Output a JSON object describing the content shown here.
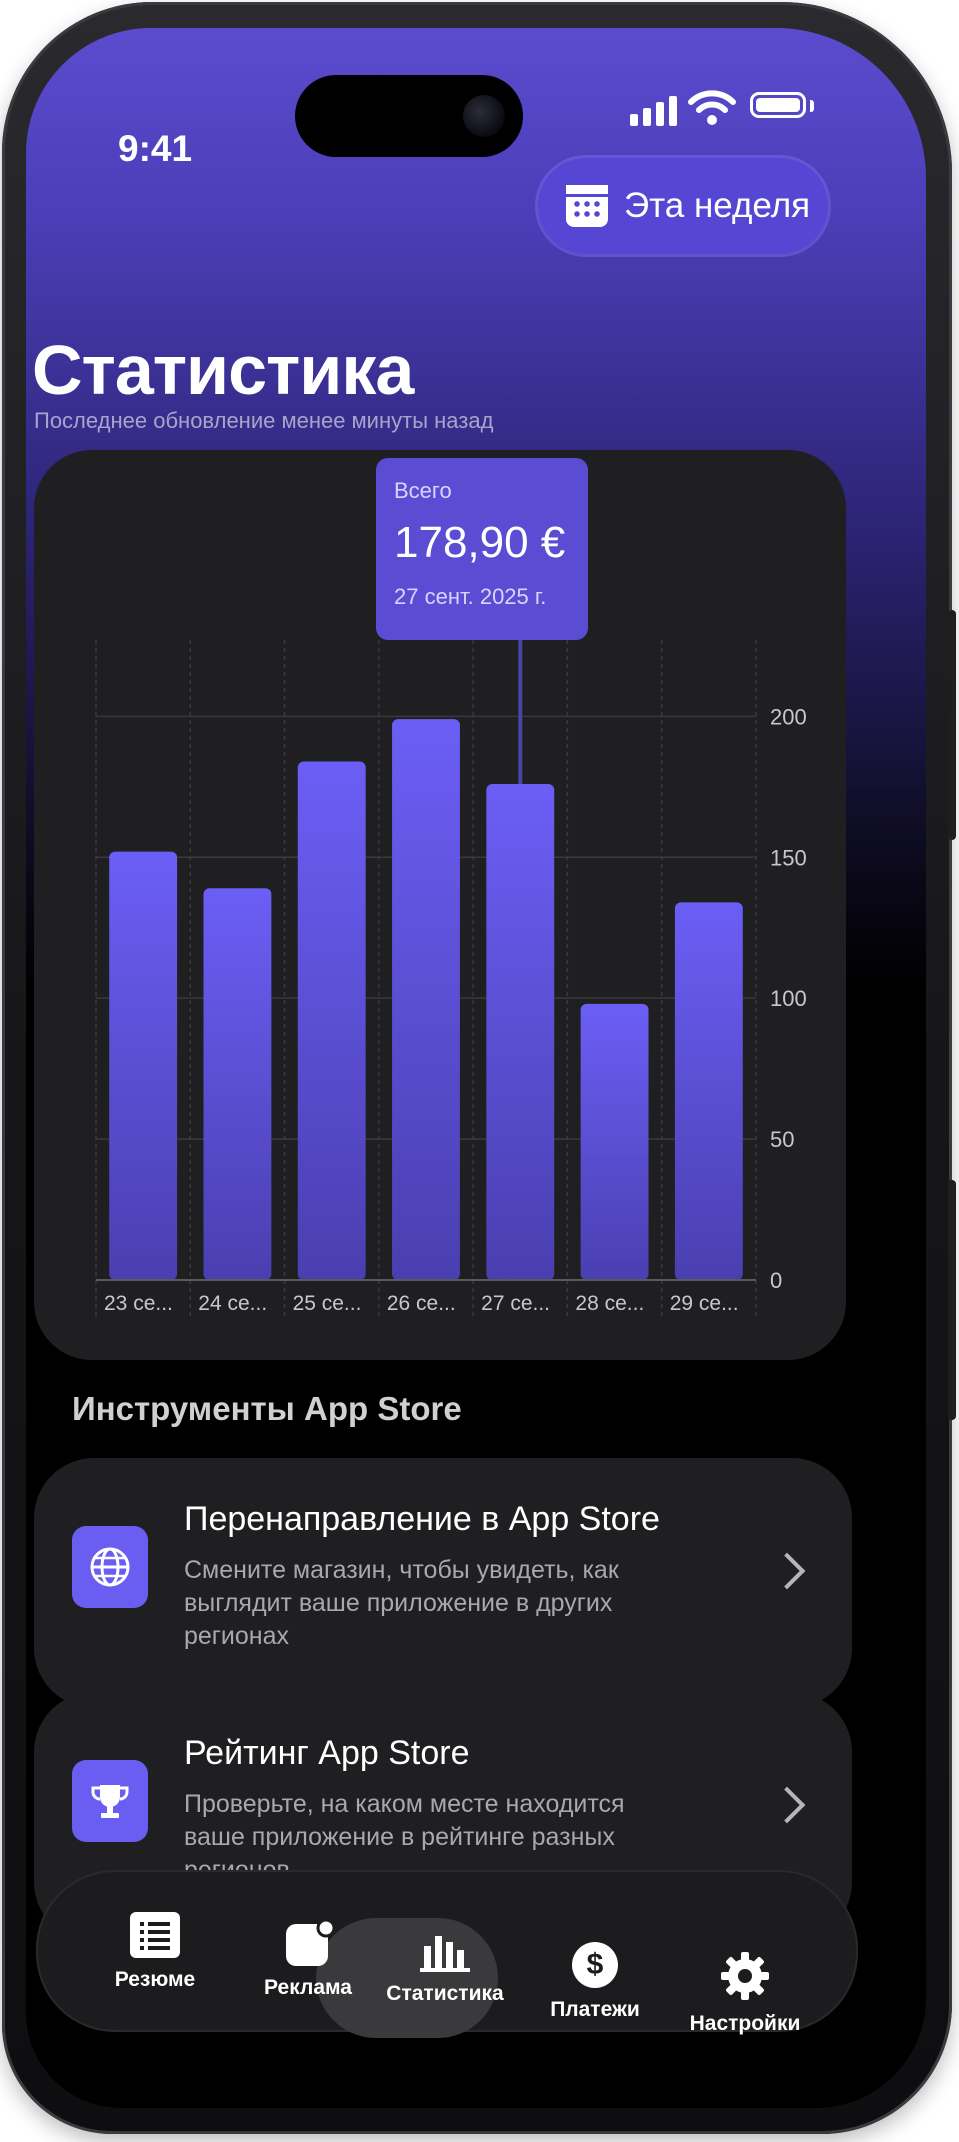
{
  "status": {
    "time": "9:41"
  },
  "header": {
    "period_label": "Эта неделя",
    "title": "Статистика",
    "subtitle": "Последнее обновление менее минуты назад"
  },
  "tooltip": {
    "label": "Всего",
    "value": "178,90 €",
    "date": "27 сент. 2025 г."
  },
  "chart_data": {
    "type": "bar",
    "categories": [
      "23 се...",
      "24 се...",
      "25 се...",
      "26 се...",
      "27 се...",
      "28 се...",
      "29 се..."
    ],
    "values": [
      152,
      139,
      184,
      199,
      176,
      98,
      134
    ],
    "y_ticks": [
      "0",
      "50",
      "100",
      "150",
      "200"
    ],
    "ylim": [
      0,
      220
    ],
    "highlighted_index": 4,
    "bar_color": "#6a5ef2",
    "grid": true
  },
  "tools": {
    "section_title": "Инструменты App Store",
    "items": [
      {
        "title": "Перенаправление в App Store",
        "description": "Смените магазин, чтобы увидеть, как выглядит ваше приложение в других регионах",
        "icon": "globe-icon"
      },
      {
        "title": "Рейтинг App Store",
        "description": "Проверьте, на каком месте находится ваше приложение в рейтинге разных регионов",
        "icon": "trophy-icon"
      }
    ]
  },
  "tabs": [
    {
      "label": "Резюме",
      "icon": "list-icon"
    },
    {
      "label": "Реклама",
      "icon": "notification-badge-icon"
    },
    {
      "label": "Статистика",
      "icon": "bar-chart-icon",
      "active": true
    },
    {
      "label": "Платежи",
      "icon": "dollar-icon"
    },
    {
      "label": "Настройки",
      "icon": "gear-icon"
    }
  ],
  "colors": {
    "accent": "#6a5ef2",
    "background": "#000000",
    "card": "#1f1f21"
  }
}
